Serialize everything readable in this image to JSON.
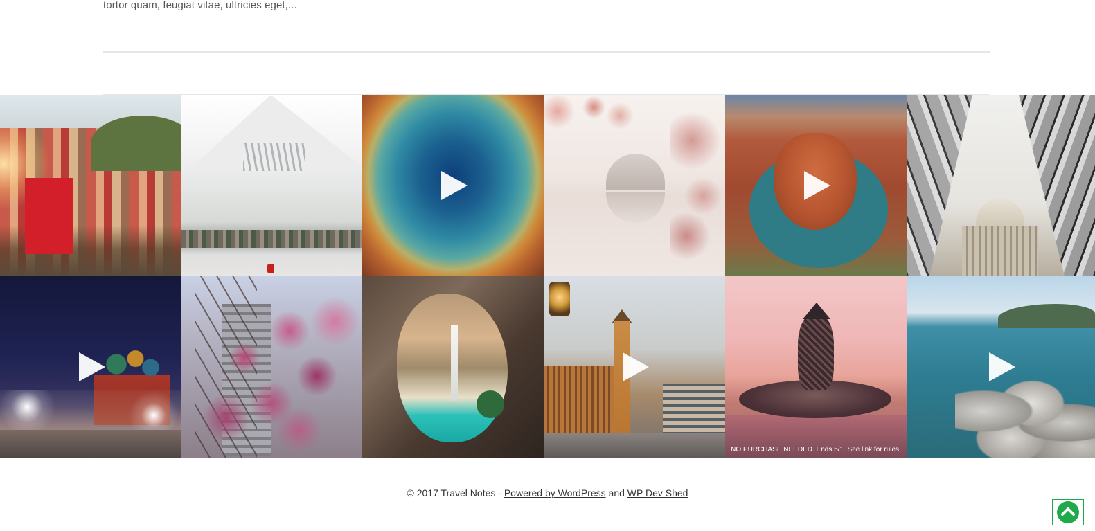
{
  "post_excerpt": {
    "text": "tortor quam, feugiat vitae, ultricies eget,..."
  },
  "gallery": {
    "items": [
      {
        "icon": "photo",
        "has_play": false,
        "caption": ""
      },
      {
        "icon": "photo",
        "has_play": false,
        "caption": ""
      },
      {
        "icon": "video",
        "has_play": true,
        "caption": ""
      },
      {
        "icon": "photo",
        "has_play": false,
        "caption": ""
      },
      {
        "icon": "video",
        "has_play": true,
        "caption": ""
      },
      {
        "icon": "photo",
        "has_play": false,
        "caption": ""
      },
      {
        "icon": "video",
        "has_play": true,
        "caption": ""
      },
      {
        "icon": "photo",
        "has_play": false,
        "caption": ""
      },
      {
        "icon": "photo",
        "has_play": false,
        "caption": ""
      },
      {
        "icon": "video",
        "has_play": true,
        "caption": ""
      },
      {
        "icon": "photo",
        "has_play": false,
        "caption": "NO PURCHASE NEEDED. Ends 5/1. See link for rules."
      },
      {
        "icon": "video",
        "has_play": true,
        "caption": ""
      }
    ]
  },
  "footer": {
    "copyright": "© 2017 Travel Notes - ",
    "powered_by_link": "Powered by WordPress",
    "and_text": " and ",
    "dev_link": "WP Dev Shed"
  },
  "back_to_top": {
    "icon": "chevron-up-circle-icon",
    "color": "#1eaa4a"
  },
  "colors": {
    "divider": "#e6e6e6",
    "text": "#333333"
  }
}
